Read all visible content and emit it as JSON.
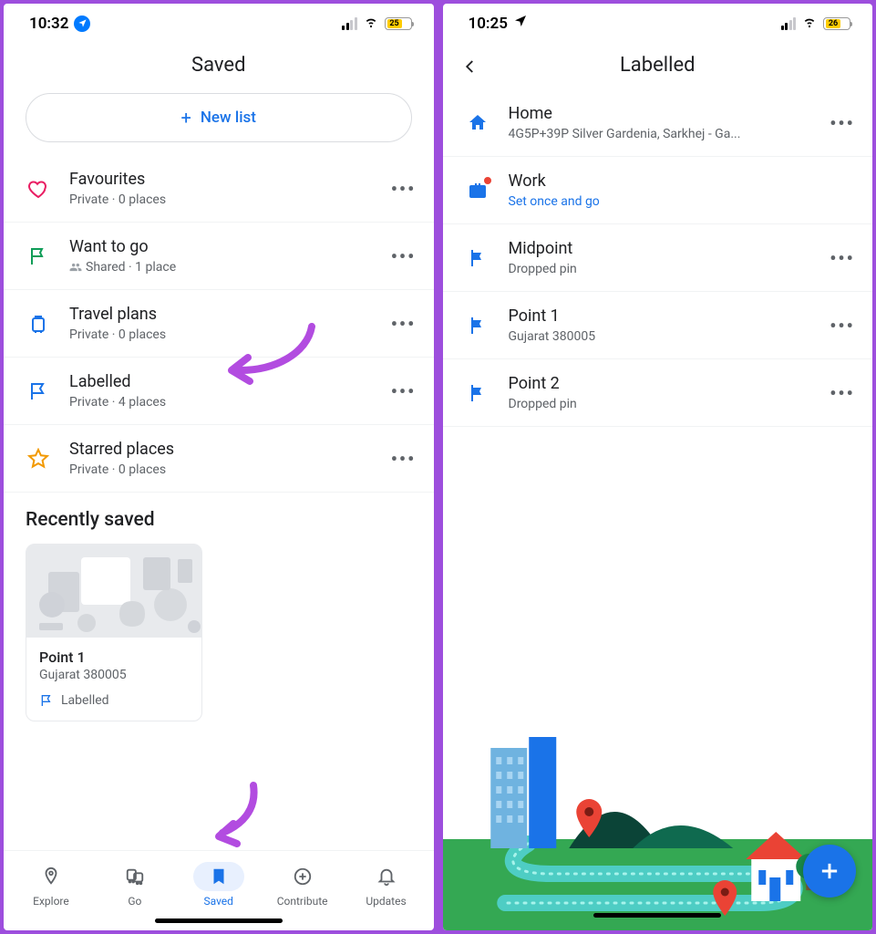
{
  "left": {
    "status": {
      "time": "10:32",
      "battery": "25"
    },
    "header_title": "Saved",
    "new_list_label": "New list",
    "lists": [
      {
        "title": "Favourites",
        "sub": "Private · 0 places",
        "icon": "heart",
        "color": "#e91e63"
      },
      {
        "title": "Want to go",
        "sub": "Shared · 1 place",
        "icon": "flag-outline",
        "color": "#0f9d58",
        "shared": true
      },
      {
        "title": "Travel plans",
        "sub": "Private · 0 places",
        "icon": "suitcase",
        "color": "#1a73e8"
      },
      {
        "title": "Labelled",
        "sub": "Private · 4 places",
        "icon": "flag-open",
        "color": "#1a73e8"
      },
      {
        "title": "Starred places",
        "sub": "Private · 0 places",
        "icon": "star",
        "color": "#f29900"
      }
    ],
    "recent_header": "Recently saved",
    "recent_card": {
      "title": "Point 1",
      "sub": "Gujarat 380005",
      "tag": "Labelled"
    },
    "bottom_nav": [
      {
        "label": "Explore",
        "icon": "pin"
      },
      {
        "label": "Go",
        "icon": "transit"
      },
      {
        "label": "Saved",
        "icon": "bookmark",
        "active": true
      },
      {
        "label": "Contribute",
        "icon": "plus-circle"
      },
      {
        "label": "Updates",
        "icon": "bell"
      }
    ]
  },
  "right": {
    "status": {
      "time": "10:25",
      "battery": "26"
    },
    "header_title": "Labelled",
    "items": [
      {
        "title": "Home",
        "sub": "4G5P+39P Silver Gardenia, Sarkhej - Ga...",
        "icon": "home"
      },
      {
        "title": "Work",
        "sub": "Set once and go",
        "icon": "briefcase",
        "sub_link": true,
        "badge": true
      },
      {
        "title": "Midpoint",
        "sub": "Dropped pin",
        "icon": "flag"
      },
      {
        "title": "Point 1",
        "sub": "Gujarat 380005",
        "icon": "flag"
      },
      {
        "title": "Point 2",
        "sub": "Dropped pin",
        "icon": "flag"
      }
    ]
  }
}
